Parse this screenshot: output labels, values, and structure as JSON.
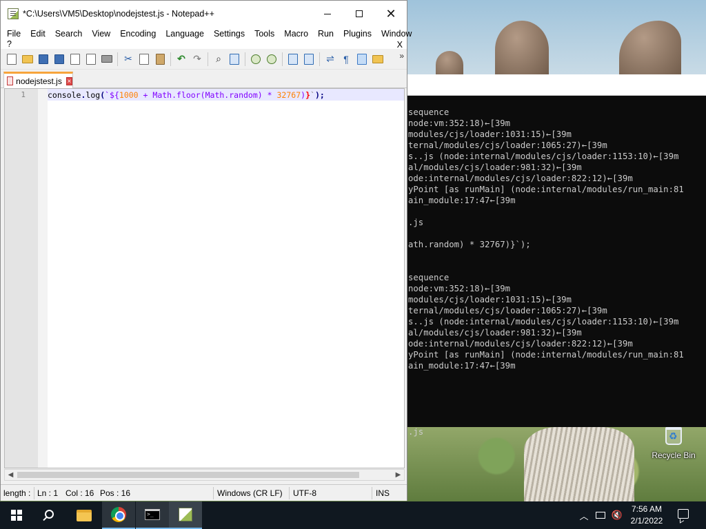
{
  "notepad": {
    "title": "*C:\\Users\\VM5\\Desktop\\nodejstest.js - Notepad++",
    "menu": [
      "File",
      "Edit",
      "Search",
      "View",
      "Encoding",
      "Language",
      "Settings",
      "Tools",
      "Macro",
      "Run",
      "Plugins",
      "Window"
    ],
    "menu_help": "?",
    "menu_close_doc": "X",
    "toolbar_more": "»",
    "tab_label": "nodejstest.js",
    "tab_close": "×",
    "line_number": "1",
    "code": {
      "p1": "console",
      "p2": ".",
      "p3": "log",
      "p4": "(",
      "p5": "`${",
      "p6": "1000",
      "p7": " + ",
      "p8": "Math",
      "p9": ".",
      "p10": "floor",
      "p11": "(",
      "p12": "Math",
      "p13": ".",
      "p14": "random",
      "p15": ")",
      "p16": " * ",
      "p17": "32767",
      "p18": ")",
      "p19": "}",
      "p20": "`",
      "p21": ");"
    },
    "status": {
      "length": "length :",
      "line": "Ln : 1",
      "col": "Col : 16",
      "pos": "Pos : 16",
      "eol": "Windows (CR LF)",
      "encoding": "UTF-8",
      "mode": "INS"
    }
  },
  "console": {
    "lines": [
      "sequence",
      "node:vm:352:18)←[39m",
      "modules/cjs/loader:1031:15)←[39m",
      "ternal/modules/cjs/loader:1065:27)←[39m",
      "s..js (node:internal/modules/cjs/loader:1153:10)←[39m",
      "al/modules/cjs/loader:981:32)←[39m",
      "ode:internal/modules/cjs/loader:822:12)←[39m",
      "yPoint [as runMain] (node:internal/modules/run_main:81",
      "ain_module:17:47←[39m",
      "",
      ".js",
      "",
      "ath.random) * 32767)}`);",
      "",
      "",
      "sequence",
      "node:vm:352:18)←[39m",
      "modules/cjs/loader:1031:15)←[39m",
      "ternal/modules/cjs/loader:1065:27)←[39m",
      "s..js (node:internal/modules/cjs/loader:1153:10)←[39m",
      "al/modules/cjs/loader:981:32)←[39m",
      "ode:internal/modules/cjs/loader:822:12)←[39m",
      "yPoint [as runMain] (node:internal/modules/run_main:81",
      "ain_module:17:47←[39m",
      "",
      "",
      "",
      "",
      "",
      ".js"
    ]
  },
  "desktop": {
    "recycle_bin_label": "Recycle Bin"
  },
  "taskbar": {
    "time": "7:56 AM",
    "date": "2/1/2022"
  }
}
